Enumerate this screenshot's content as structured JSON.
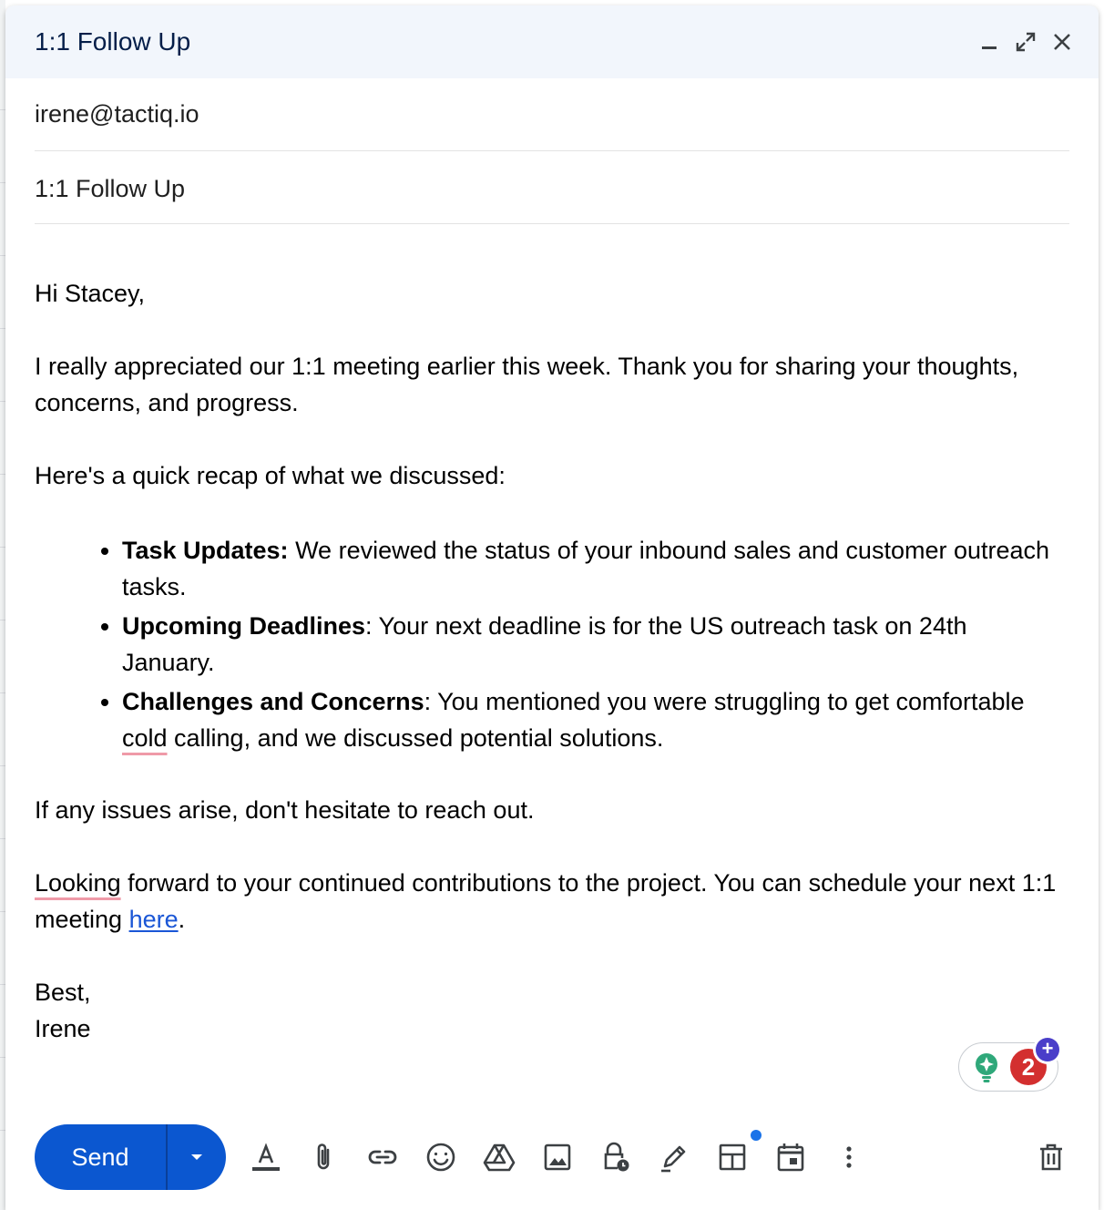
{
  "window": {
    "title": "1:1 Follow Up"
  },
  "compose": {
    "to": "irene@tactiq.io",
    "subject": "1:1 Follow Up"
  },
  "body": {
    "greeting": "Hi Stacey,",
    "intro": "I really appreciated our 1:1 meeting earlier this week. Thank you for sharing your thoughts, concerns, and progress.",
    "recap_lead": "Here's a quick recap of what we discussed:",
    "bullets": [
      {
        "label": "Task Updates:",
        "text": " We reviewed the status of your inbound sales and customer outreach tasks."
      },
      {
        "label": "Upcoming Deadlines",
        "text": ": Your next deadline is for the US outreach task on 24th January."
      },
      {
        "label": "Challenges and Concerns",
        "text_before": ": You mentioned you were struggling to get comfortable ",
        "text_flagged": "cold",
        "text_after": " calling, and we discussed potential solutions."
      }
    ],
    "issues": "If any issues arise, don't hesitate to reach out.",
    "closing_flagged": "Looking",
    "closing_rest": " forward to your continued contributions to the project. You can schedule your next 1:1 meeting ",
    "closing_link": "here",
    "closing_end": ".",
    "signoff": "Best,",
    "signature": "Irene"
  },
  "addon": {
    "badge_count": "2",
    "plus": "+"
  },
  "toolbar": {
    "send_label": "Send",
    "tools": [
      "formatting-icon",
      "attach-icon",
      "link-icon",
      "emoji-icon",
      "drive-icon",
      "image-icon",
      "confidential-icon",
      "signature-icon",
      "layout-icon",
      "schedule-icon",
      "more-options-icon",
      "trash-icon"
    ]
  },
  "colors": {
    "accent": "#0b57d0",
    "titlebar": "#f2f6fc",
    "link": "#1a56d6",
    "spellcheck": "#ef9aa8",
    "badge": "#d32f2f"
  }
}
